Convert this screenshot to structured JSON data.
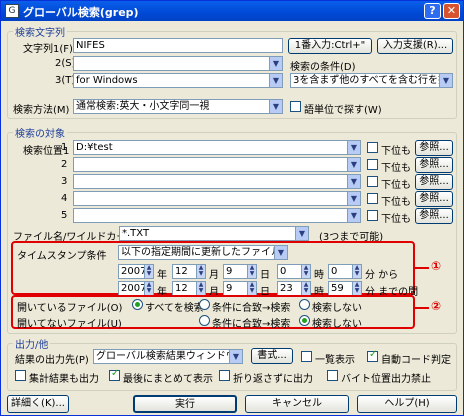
{
  "title": "グローバル検索(grep)",
  "search_strings": {
    "group": "検索文字列",
    "row1_label": "文字列1(F)",
    "row1_value": "NIFES",
    "row2_label": "2(S)",
    "row2_value": "",
    "row3_label": "3(T)",
    "row3_value": "for Windows",
    "insert_btn": "1番入力:Ctrl+\"",
    "history_btn": "入力支援(R)...",
    "cond_label": "検索の条件(D)",
    "cond_value": "3を含まず他のすべてを含む行を探す",
    "method_label": "検索方法(M)",
    "method_value": "通常検索:英大・小文字同一視",
    "word_unit": "語単位で探す(W)"
  },
  "targets": {
    "group": "検索の対象",
    "loc_label": "検索位置1",
    "rows": [
      {
        "label": "1",
        "value": "D:¥test"
      },
      {
        "label": "2",
        "value": ""
      },
      {
        "label": "3",
        "value": ""
      },
      {
        "label": "4",
        "value": ""
      },
      {
        "label": "5",
        "value": ""
      }
    ],
    "subdir": "下位も",
    "browse": "参照...",
    "file_label": "ファイル名/ワイルドカード(N)",
    "file_value": "*.TXT",
    "file_note": "(3つまで可能)"
  },
  "timestamp": {
    "label": "タイムスタンプ条件",
    "mode": "以下の指定期間に更新したファイル",
    "from": {
      "y": "2007",
      "m": "12",
      "d": "9",
      "h": "0",
      "mi": "0",
      "suffix": "分 から"
    },
    "to": {
      "y": "2007",
      "m": "12",
      "d": "9",
      "h": "23",
      "mi": "59",
      "suffix": "分 までの間"
    },
    "year": "年",
    "month": "月",
    "day": "日",
    "hour": "時",
    "marker": "①"
  },
  "open_files": {
    "open_label": "開いているファイル(O)",
    "closed_label": "開いてないファイル(U)",
    "opt_all": "すべてを検索",
    "opt_cond": "条件に合致→検索",
    "opt_none": "検索しない",
    "marker": "②"
  },
  "output": {
    "group": "出力/他",
    "dest_label": "結果の出力先(P)",
    "dest_value": "グローバル検索結果ウィンドウ",
    "format_btn": "書式...",
    "list_display": "一覧表示",
    "auto_code": "自動コード判定",
    "collect": "集計結果も出力",
    "summary": "最後にまとめて表示",
    "wrap": "折り返さずに出力",
    "byte_pos": "バイト位置出力禁止"
  },
  "footer": {
    "narrow": "詳細く(K)...",
    "run": "実行",
    "cancel": "キャンセル",
    "help": "ヘルプ(H)"
  },
  "colors": {
    "accent": "#0054E3",
    "highlight": "#E00000"
  }
}
